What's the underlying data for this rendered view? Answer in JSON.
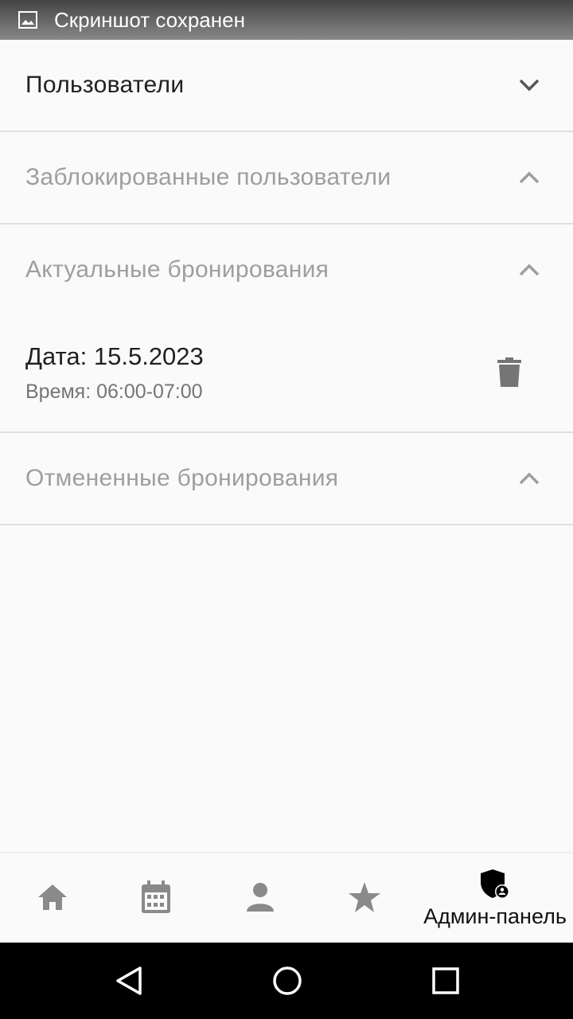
{
  "status_bar": {
    "icon": "image-icon",
    "text": "Скриншот сохранен"
  },
  "sections": [
    {
      "title": "Пользователи",
      "state": "collapsed",
      "chevron": "chevron-down-icon"
    },
    {
      "title": "Заблокированные пользователи",
      "state": "expanded",
      "chevron": "chevron-up-icon"
    },
    {
      "title": "Актуальные бронирования",
      "state": "expanded",
      "chevron": "chevron-up-icon"
    },
    {
      "title": "Отмененные бронирования",
      "state": "expanded",
      "chevron": "chevron-up-icon"
    }
  ],
  "booking": {
    "date": "Дата: 15.5.2023",
    "time": "Время: 06:00-07:00",
    "action_icon": "trash-icon"
  },
  "bottom_nav": {
    "items": [
      {
        "icon": "home-icon",
        "label": ""
      },
      {
        "icon": "calendar-icon",
        "label": ""
      },
      {
        "icon": "person-icon",
        "label": ""
      },
      {
        "icon": "star-icon",
        "label": ""
      },
      {
        "icon": "admin-shield-icon",
        "label": "Админ-панель",
        "active": true
      }
    ]
  },
  "colors": {
    "background": "#fafafa",
    "text_primary": "#212121",
    "text_muted": "#9e9e9e",
    "icon_inactive": "#8a8a8a",
    "icon_active": "#000000",
    "divider": "#e0e0e0"
  }
}
